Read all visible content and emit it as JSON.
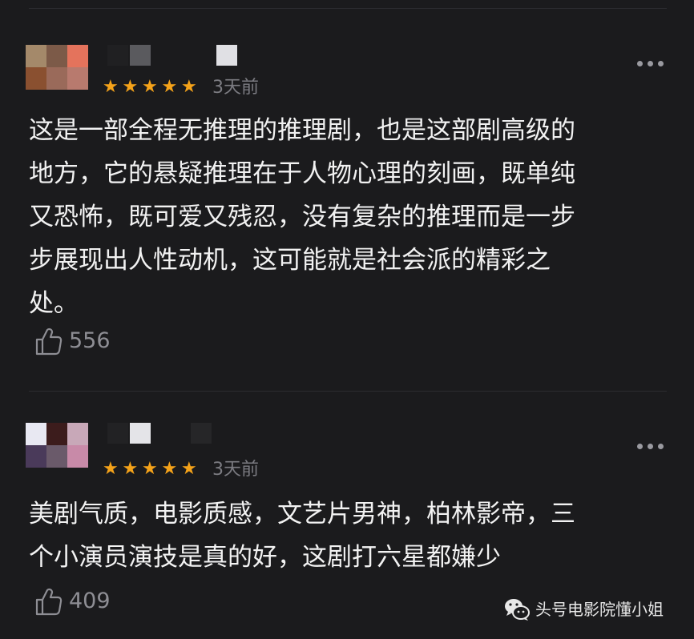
{
  "comments": [
    {
      "rating_stars": "★★★★★",
      "rating_value": 5,
      "time": "3天前",
      "text": "这是一部全程无推理的推理剧，也是这部剧高级的\n地方，它的悬疑推理在于人物心理的刻画，既单纯\n又恐怖，既可爱又残忍，没有复杂的推理而是一步\n步展现出人性动机，这可能就是社会派的精彩之\n处。",
      "likes": "556",
      "avatar_colors": [
        "#a4896a",
        "#7c5a48",
        "#e4735c",
        "#8a5030",
        "#9a6a5a",
        "#b87a6e"
      ]
    },
    {
      "rating_stars": "★★★★★",
      "rating_value": 5,
      "time": "3天前",
      "text": "美剧气质，电影质感，文艺片男神，柏林影帝，三\n个小演员演技是真的好，这剧打六星都嫌少",
      "likes": "409",
      "avatar_colors": [
        "#e8e8f2",
        "#3c1c1c",
        "#c8a8b8",
        "#4a3a5a",
        "#6a5a6a",
        "#c88aa8"
      ]
    }
  ],
  "watermark": {
    "text": "头号电影院懂小姐",
    "icon": "wechat-icon"
  },
  "icons": {
    "like": "thumbs-up-icon",
    "more": "more-dots-icon"
  },
  "colors": {
    "background": "#1b1b1d",
    "star": "#f5a31a",
    "muted": "#7c7c82"
  }
}
